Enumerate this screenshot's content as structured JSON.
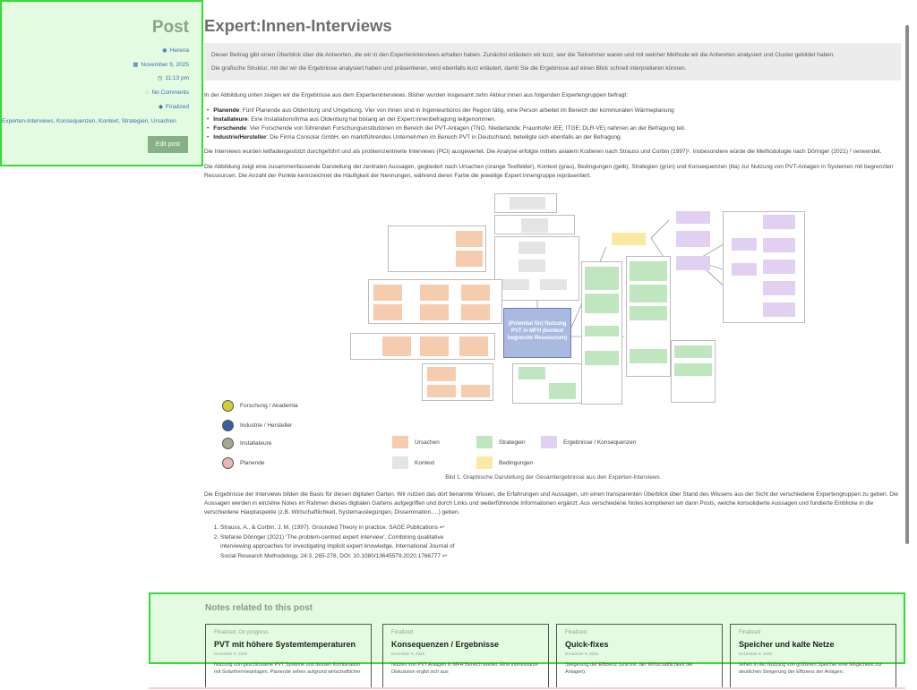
{
  "sidebar": {
    "title": "Post",
    "author": "Herena",
    "date": "November 9, 2025",
    "time": "11:13 pm",
    "comments": "No Comments",
    "status": "Finalized",
    "tags": "Experten-Interviews, Konsequenzen, Kontext, Strategien, Ursachen",
    "edit_label": "Edit post"
  },
  "main": {
    "title": "Expert:Innen-Interviews",
    "intro": [
      "Dieser Beitrag gibt einen Überblick über die Antworten, die wir in den Experteninterviews erhalten haben. Zunächst erläutern wir kurz, wer die Teilnehmer waren und mit welcher Methode wir die Antworten analysiert und Cluster gebildet haben.",
      "Die grafische Struktur, mit der wir die Ergebnisse analysiert haben und präsentieren, wird ebenfalls kurz erläutert, damit Sie die Ergebnisse auf einen Blick schnell interpretieren können."
    ],
    "lead": "In der Abbildung unten zeigen wir die Ergebnisse aus dem Experteninterviews. Bisher wurden insgesamt zehn Akteur:innen aus folgenden Expertengruppen befragt:",
    "groups": [
      {
        "name": "Planende",
        "text": ": Fünf Planende aus Oldenburg und Umgebung. Vier von ihnen sind in Ingenieurbüros der Region tätig, eine Person arbeitet im Bereich der kommunalen Wärmeplanung"
      },
      {
        "name": "Installateure",
        "text": ": Eine Installationsfirma aus Oldenburg hat bislang an der Expert:innenbefragung teilgenommen."
      },
      {
        "name": "Forschende",
        "text": ": Vier Forschende von führenden Forschungsinstitutionen im Bereich der PVT-Anlagen (TNO, Niederlande; Fraunhofer IEE; ITGE; DLR-VE) nahmen an der Befragung teil."
      },
      {
        "name": "Industrie/Hersteller",
        "text": ": Die Firma Consolar GmbH, ein marktführendes Unternehmen im Bereich PVT in Deutschland, beteiligte sich ebenfalls an der Befragung."
      }
    ],
    "method": "Die Interviews wurden leitfadengestützt durchgeführt und als problemzentrierte Interviews (PCI) ausgewertet. Die Analyse erfolgte mittels axialem Kodieren nach Strauss und Corbin (1997)¹. Insbesondere würde die Methodologie nach Döringer (2021) ² verwendet.",
    "figure_desc": "Die Abbildung zeigt eine zusammenfassende Darstellung der zentralen Aussagen, gegliedert nach Ursachen (orange Textfelder), Kontext (grau), Bedingungen (gelb), Strategien (grün) und Konsequenzen (lila) zur Nutzung von PVT-Anlagen in Systemen mit begrenzten Ressourcen. Die Anzahl der Punkte kennzeichnet die Häufigkeit der Nennungen, während deren Farbe die jeweilige Expert:innengruppe repräsentiert.",
    "center_label": "(Potential für) Nutzung PVT in MFH (kontext begrenzte Ressourcen)",
    "legend": {
      "forschung": "Forschung / Akademia",
      "industrie": "Industrie / Hersteller",
      "installateure": "Installateure",
      "planende": "Planende",
      "ursachen": "Ursachen",
      "kontext": "Kontext",
      "strategien": "Strategien",
      "bedingungen": "Bedingungen",
      "ergebnisse": "Ergebnisse / Konsequenzen"
    },
    "caption": "Bild 1. Graphische Darstellung der Gesamtergebnisse aus den Experten-Interviews",
    "closing": "Die Ergebnisse der Interviews bilden die Basis für diesen digitalen Garten. Wir nutzen das dort benannte Wissen, die Erfahrungen und Aussagen, um einen transparenten Überblick über Stand des Wissens aus der Sicht der verschiedene Expertengruppen zu geben. Die Aussagen werden in einzelne Notes im Rahmen dieses digitalen Gartens aufgegriffen und durch Links und weiterführende Informationen ergänzt. Aus verschiedene Notes kompilieren wir dann Posts, welche konsolidierte Aussagen und fundierte Einblicke in die verschiedene Hauptaspekte (z.B. Wirtschaftlichkeit, Systemauslegungen, Dissemination,…) geben.",
    "refs": [
      "Strauss, A., & Corbin, J. M. (1997). Grounded Theory in practice. SAGE Publications ↩",
      "Stefanie Döringer (2021) ‘The problem-centred expert interview’. Combining qualitative interviewing approaches for investigating implicit expert knowledge, International Journal of Social Research Methodology, 24:3, 265-278, DOI: 10.1080/13645579.2020.1766777 ↩"
    ]
  },
  "related": {
    "heading": "Notes related to this post",
    "cards": [
      {
        "status": "Finalized, On progress",
        "title": "PVT mit höhere Systemtemperaturen",
        "date": "December 9, 2025",
        "excerpt": "Nutzung von geschlossene PVT Systeme und dessen Kombination mit Solarthermieanlagen. Planende sehen aufgrund wirtschaftlicher"
      },
      {
        "status": "Finalized",
        "title": "Konsequenzen / Ergebnisse",
        "date": "December 9, 2025",
        "excerpt": "Nutzen von PVT Anlagen in MFH Bereich wieder. Eine interessante Diskussion ergibt sich aus"
      },
      {
        "status": "Finalized",
        "title": "Quick-fixes",
        "date": "December 9, 2025",
        "excerpt": "Steigerung der Effizienz (und evt. der Wirtschaftlichkeit der Anlagen)."
      },
      {
        "status": "Finalized",
        "title": "Speicher und kalte Netze",
        "date": "December 9, 2025",
        "excerpt": "sehen in der Nutzung von größeren Speicher eine Möglichkeit zur deutlichen Steigerung der Effizienz der Anlagen."
      }
    ]
  }
}
